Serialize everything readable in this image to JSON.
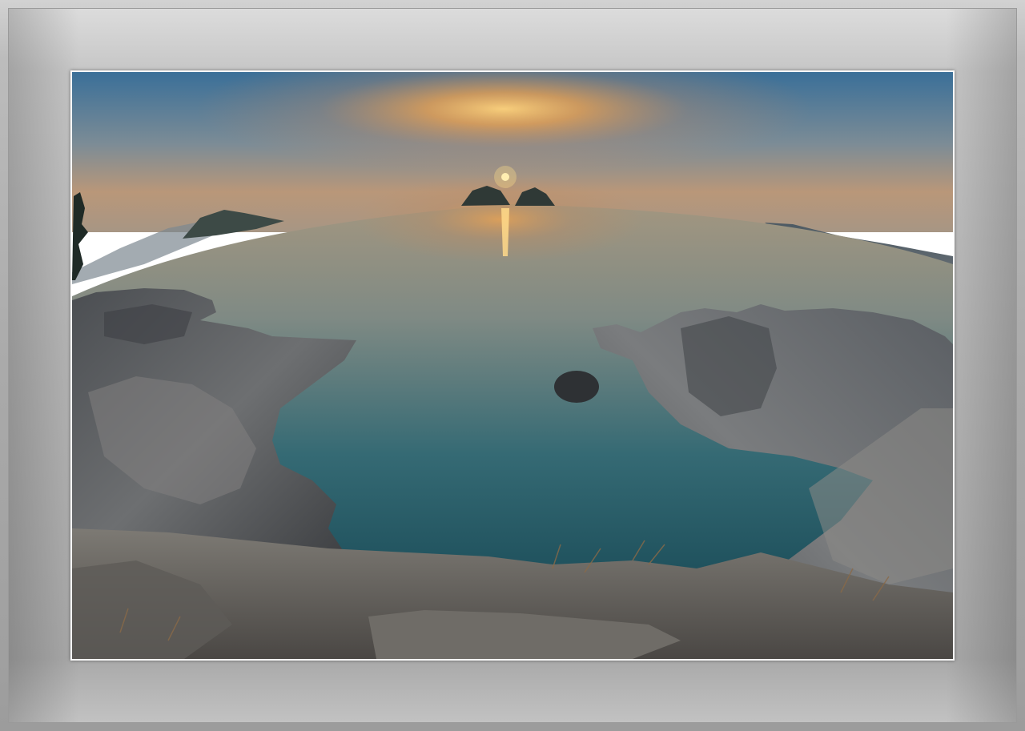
{
  "image": {
    "subject": "sunset-over-sea-framed-photo",
    "colors": {
      "sky_top": "#3d6f96",
      "sky_glow": "#f0a24a",
      "sun": "#fff2b8",
      "sea_far": "#8a8f86",
      "sea_near": "#134a57",
      "rock": "#5b5f63",
      "frame": "#b0b0b0"
    }
  }
}
